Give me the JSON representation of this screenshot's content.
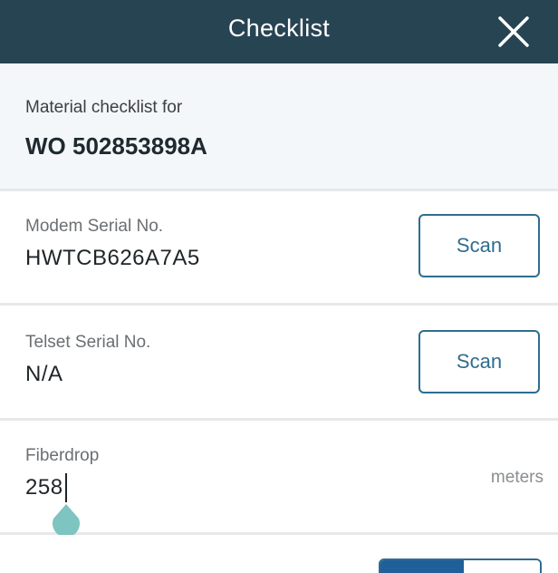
{
  "header": {
    "title": "Checklist",
    "close_icon": "close-icon"
  },
  "work_order": {
    "caption": "Material checklist for",
    "number": "WO 502853898A"
  },
  "fields": {
    "modem": {
      "label": "Modem Serial No.",
      "value": "HWTCB626A7A5",
      "button_label": "Scan"
    },
    "telset": {
      "label": "Telset Serial No.",
      "value": "N/A",
      "button_label": "Scan"
    },
    "fiberdrop": {
      "label": "Fiberdrop",
      "value": "258",
      "unit": "meters"
    }
  },
  "colors": {
    "header_bg": "#274453",
    "accent": "#2f6d8f",
    "cursor_handle": "#7ec4c0",
    "toggle_on": "#1f5f9a"
  }
}
